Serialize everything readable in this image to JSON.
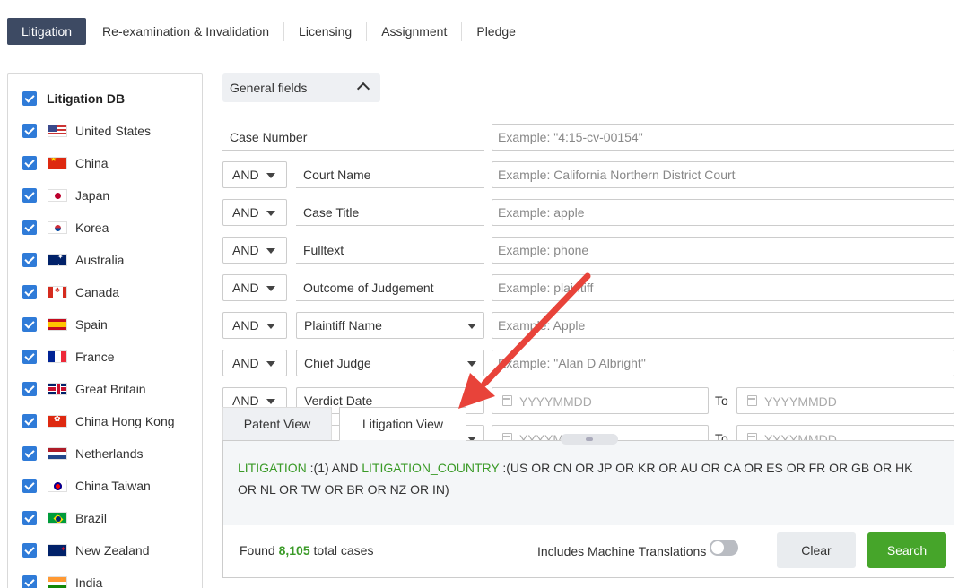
{
  "tabs": [
    "Litigation",
    "Re-examination & Invalidation",
    "Licensing",
    "Assignment",
    "Pledge"
  ],
  "sidebar": {
    "title": "Litigation DB",
    "items": [
      {
        "label": "United States",
        "flag": "us-flag-icon"
      },
      {
        "label": "China",
        "flag": "cn-flag-icon"
      },
      {
        "label": "Japan",
        "flag": "jp-flag-icon"
      },
      {
        "label": "Korea",
        "flag": "kr-flag-icon"
      },
      {
        "label": "Australia",
        "flag": "au-flag-icon"
      },
      {
        "label": "Canada",
        "flag": "ca-flag-icon"
      },
      {
        "label": "Spain",
        "flag": "es-flag-icon"
      },
      {
        "label": "France",
        "flag": "fr-flag-icon"
      },
      {
        "label": "Great Britain",
        "flag": "gb-flag-icon"
      },
      {
        "label": "China Hong Kong",
        "flag": "hk-flag-icon"
      },
      {
        "label": "Netherlands",
        "flag": "nl-flag-icon"
      },
      {
        "label": "China Taiwan",
        "flag": "tw-flag-icon"
      },
      {
        "label": "Brazil",
        "flag": "br-flag-icon"
      },
      {
        "label": "New Zealand",
        "flag": "nz-flag-icon"
      },
      {
        "label": "India",
        "flag": "in-flag-icon"
      }
    ]
  },
  "general_fields": {
    "label": "General fields"
  },
  "form": {
    "rows": [
      {
        "op": "",
        "field": "Case Number",
        "placeholder": "Example: \"4:15-cv-00154\""
      },
      {
        "op": "AND",
        "field": "Court Name",
        "placeholder": "Example: California Northern District Court"
      },
      {
        "op": "AND",
        "field": "Case Title",
        "placeholder": "Example: apple"
      },
      {
        "op": "AND",
        "field": "Fulltext",
        "placeholder": "Example: phone"
      },
      {
        "op": "AND",
        "field": "Outcome of Judgement",
        "placeholder": "Example: plaintiff"
      },
      {
        "op": "AND",
        "field": "Plaintiff Name",
        "placeholder": "Example: Apple"
      },
      {
        "op": "AND",
        "field": "Chief Judge",
        "placeholder": "Example: \"Alan D Albright\""
      },
      {
        "op": "AND",
        "field": "Verdict Date",
        "date_from": "YYYYMMDD",
        "to": "To",
        "date_to": "YYYYMMDD"
      },
      {
        "date_from": "YYYYMMDD",
        "to": "To",
        "date_to": "YYYYMMDD"
      }
    ]
  },
  "query_panel": {
    "tabs": [
      "Patent View",
      "Litigation View"
    ],
    "active_tab": "Litigation View",
    "kw1": "LITIGATION",
    "part1": " :(1) AND ",
    "kw2": "LITIGATION_COUNTRY",
    "part2": " :(US OR CN OR JP OR KR OR AU OR CA OR ES OR FR OR GB OR HK OR NL OR TW OR BR OR NZ OR IN)",
    "found_prefix": "Found ",
    "found_count": "8,105",
    "found_suffix": " total cases",
    "machine_translations": "Includes Machine Translations",
    "toggle_on": false,
    "clear": "Clear",
    "search": "Search"
  },
  "colors": {
    "active_tab": "#3d4a63",
    "checkbox": "#2f7bd8",
    "keyword_green": "#3a9a27",
    "search_button": "#46a52a",
    "annotation_arrow": "#e8433a"
  }
}
